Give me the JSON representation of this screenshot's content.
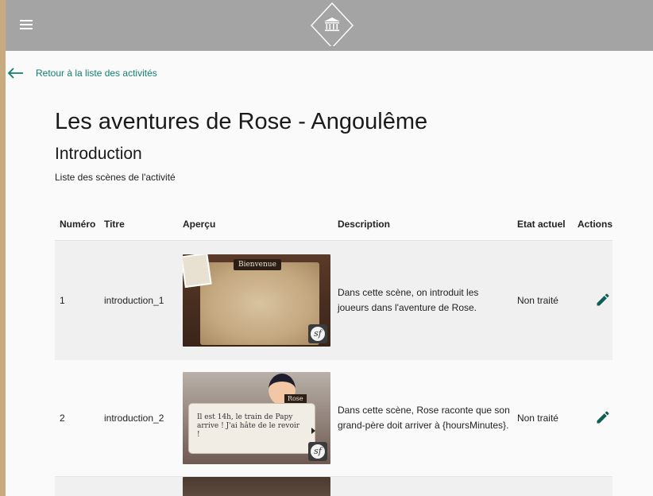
{
  "header": {
    "menu_icon": "hamburger-menu-icon",
    "logo_icon": "museum-building-icon",
    "bg_color": "#a4a4a4"
  },
  "back_link": {
    "label": "Retour à la liste des activités",
    "icon": "arrow-left-icon",
    "color": "#0f7f6f"
  },
  "activity": {
    "title": "Les aventures de Rose - Angoulême",
    "section": "Introduction",
    "caption": "Liste des scènes de l'activité"
  },
  "table": {
    "columns": [
      "Numéro",
      "Titre",
      "Aperçu",
      "Description",
      "Etat actuel",
      "Actions"
    ],
    "rows": [
      {
        "number": "1",
        "title": "introduction_1",
        "preview": {
          "banner": "Bienvenue",
          "badge_icon": "symfony-logo-icon"
        },
        "description": "Dans cette scène, on introduit les joueurs dans l'aventure de Rose.",
        "state": "Non traité",
        "action_icon": "pencil-edit-icon"
      },
      {
        "number": "2",
        "title": "introduction_2",
        "preview": {
          "name": "Rose",
          "dialog": "Il est 14h, le train de Papy arrive ! J'ai hâte de le revoir !",
          "badge_icon": "symfony-logo-icon"
        },
        "description": "Dans cette scène, Rose raconte que son grand-père doit arriver à {hoursMinutes}.",
        "state": "Non traité",
        "action_icon": "pencil-edit-icon"
      }
    ]
  },
  "colors": {
    "edit_icon": "#0f5e54",
    "accent": "#0f7f6f",
    "row_alt": "#f0f0f0"
  }
}
